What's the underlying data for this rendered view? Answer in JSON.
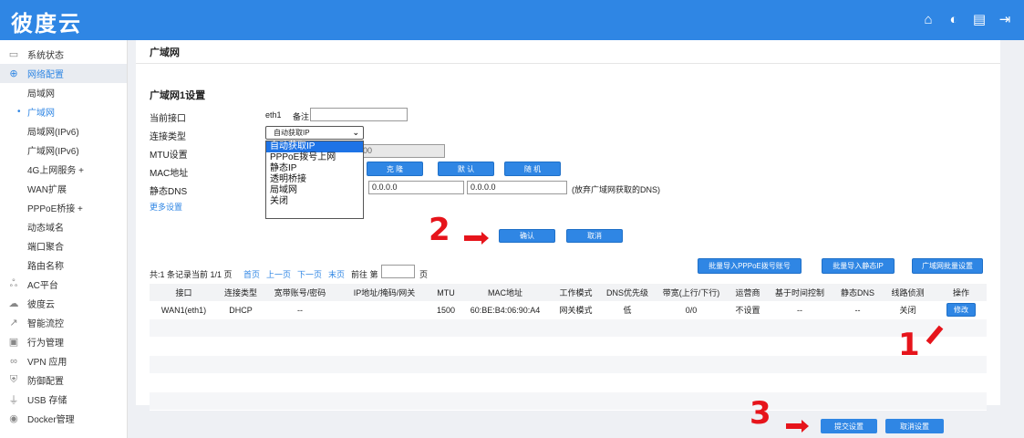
{
  "app": {
    "logo_text": "彼度云",
    "top_icons": [
      "home-icon",
      "play-icon",
      "screen-icon",
      "exit-icon"
    ]
  },
  "sidebar": {
    "items": [
      {
        "label": "系统状态",
        "icon": "monitor-icon"
      },
      {
        "label": "网络配置",
        "icon": "globe-icon"
      },
      {
        "label": "局域网"
      },
      {
        "label": "广域网"
      },
      {
        "label": "局域网(IPv6)"
      },
      {
        "label": "广域网(IPv6)"
      },
      {
        "label": "4G上网服务 +"
      },
      {
        "label": "WAN扩展"
      },
      {
        "label": "PPPoE桥接 +"
      },
      {
        "label": "动态域名"
      },
      {
        "label": "端口聚合"
      },
      {
        "label": "路由名称"
      },
      {
        "label": "AC平台",
        "icon": "network-icon"
      },
      {
        "label": "彼度云",
        "icon": "cloud-icon"
      },
      {
        "label": "智能流控",
        "icon": "chart-icon"
      },
      {
        "label": "行为管理",
        "icon": "behavior-icon"
      },
      {
        "label": "VPN 应用",
        "icon": "vpn-icon"
      },
      {
        "label": "防御配置",
        "icon": "shield-icon"
      },
      {
        "label": "USB 存储",
        "icon": "usb-icon"
      },
      {
        "label": "Docker管理",
        "icon": "docker-icon"
      }
    ]
  },
  "panel": {
    "header": "广域网",
    "section_title": "广域网1设置",
    "labels": {
      "interface": "当前接口",
      "conn_type": "连接类型",
      "mtu": "MTU设置",
      "mac": "MAC地址",
      "dns": "静态DNS",
      "more": "更多设置"
    },
    "interface_value": "eth1",
    "remark_label": "备注",
    "remark_value": "",
    "conn_type_selected": "自动获取IP",
    "conn_type_options": [
      "自动获取IP",
      "PPPoE拨号上网",
      "静态IP",
      "透明桥接",
      "局域网",
      "关闭"
    ],
    "mtu_value": "00",
    "mac_buttons": [
      "克 隆",
      "默 认",
      "随 机"
    ],
    "dns1": "0.0.0.0",
    "dns2": "0.0.0.0",
    "dns_note": "(放弃广域网获取的DNS)",
    "confirm": "确认",
    "cancel": "取消",
    "pager": {
      "summary": "共:1 条记录当前 1/1 页",
      "first": "首页",
      "prev": "上一页",
      "next": "下一页",
      "last": "末页",
      "goto_prefix": "前往 第",
      "goto_suffix": "页",
      "page_value": ""
    },
    "bulk_buttons": [
      "批量导入PPPoE拨号账号",
      "批量导入静态IP",
      "广域网批量设置"
    ],
    "table": {
      "headers": [
        "接口",
        "连接类型",
        "宽带账号/密码",
        "IP地址/掩码/网关",
        "MTU",
        "MAC地址",
        "工作模式",
        "DNS优先级",
        "带宽(上行/下行)",
        "运营商",
        "基于时间控制",
        "静态DNS",
        "线路侦测",
        "操作"
      ],
      "rows": [
        [
          "WAN1(eth1)",
          "DHCP",
          "--",
          "",
          "1500",
          "60:BE:B4:06:90:A4",
          "网关模式",
          "低",
          "0/0",
          "不设置",
          "--",
          "--",
          "关闭",
          "修改"
        ]
      ]
    },
    "markers": [
      "1",
      "2",
      "3"
    ]
  },
  "bottom": {
    "submit": "提交设置",
    "cancel_settings": "取消设置"
  }
}
